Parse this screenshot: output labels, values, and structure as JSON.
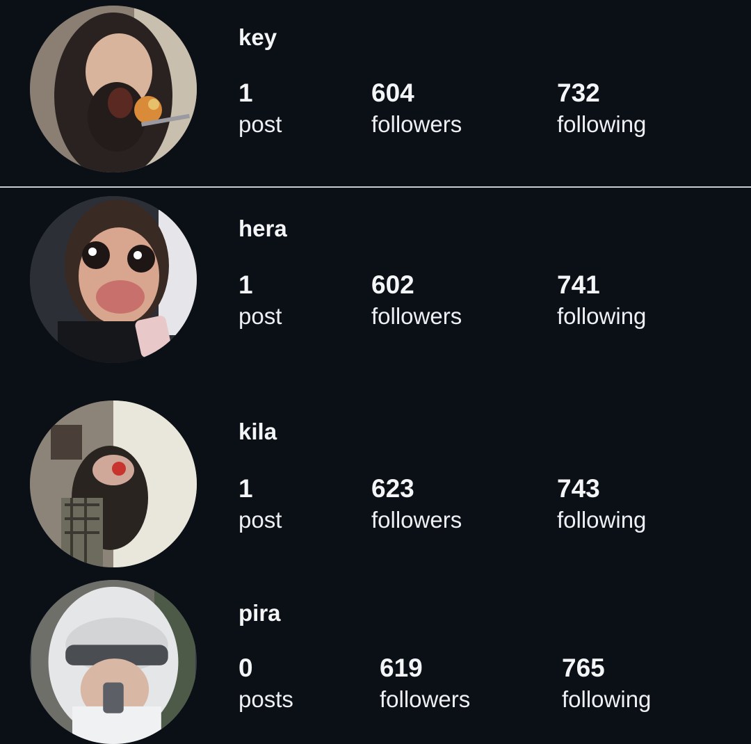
{
  "profiles": [
    {
      "username": "key",
      "posts": {
        "value": "1",
        "label": "post"
      },
      "followers": {
        "value": "604",
        "label": "followers"
      },
      "following": {
        "value": "732",
        "label": "following"
      }
    },
    {
      "username": "hera",
      "posts": {
        "value": "1",
        "label": "post"
      },
      "followers": {
        "value": "602",
        "label": "followers"
      },
      "following": {
        "value": "741",
        "label": "following"
      }
    },
    {
      "username": "kila",
      "posts": {
        "value": "1",
        "label": "post"
      },
      "followers": {
        "value": "623",
        "label": "followers"
      },
      "following": {
        "value": "743",
        "label": "following"
      }
    },
    {
      "username": "pira",
      "posts": {
        "value": "0",
        "label": "posts"
      },
      "followers": {
        "value": "619",
        "label": "followers"
      },
      "following": {
        "value": "765",
        "label": "following"
      }
    }
  ]
}
